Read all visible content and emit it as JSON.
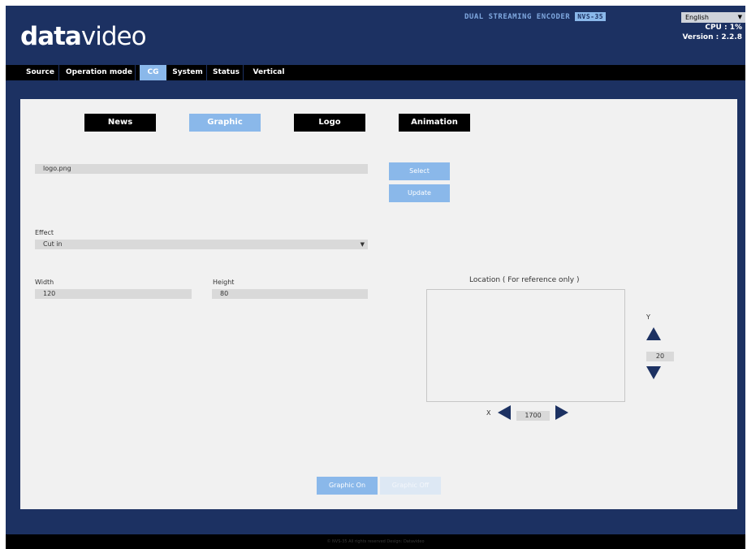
{
  "header": {
    "brand_bold": "data",
    "brand_thin": "video",
    "product_name": "DUAL STREAMING ENCODER",
    "model": "NVS-35",
    "language": "English",
    "cpu": "CPU : 1%",
    "version": "Version : 2.2.8"
  },
  "nav": {
    "tabs": [
      "Source",
      "Operation mode",
      "CG",
      "System",
      "Status",
      "Vertical"
    ],
    "active": "CG"
  },
  "cg": {
    "tabs": [
      "News",
      "Graphic",
      "Logo",
      "Animation"
    ],
    "active": "Graphic",
    "file_value": "logo.png",
    "select_label": "Select",
    "update_label": "Update",
    "effect_label": "Effect",
    "effect_value": "Cut in",
    "width_label": "Width",
    "width_value": "120",
    "height_label": "Height",
    "height_value": "80",
    "location_title": "Location ( For reference only )",
    "y_label": "Y",
    "y_value": "20",
    "x_label": "X",
    "x_value": "1700",
    "graphic_on_label": "Graphic On",
    "graphic_off_label": "Graphic Off"
  },
  "footer": {
    "text": "© NVS-35 All rights reserved Design: Datavideo"
  },
  "colors": {
    "background": "#1c3162",
    "accent": "#8ab8ea",
    "panel": "#f1f1f1",
    "nav_bar": "#000000"
  },
  "icons": {
    "y_up": "triangle-up-icon",
    "y_down": "triangle-down-icon",
    "x_left": "triangle-left-icon",
    "x_right": "triangle-right-icon",
    "dropdown": "chevron-down-icon"
  }
}
